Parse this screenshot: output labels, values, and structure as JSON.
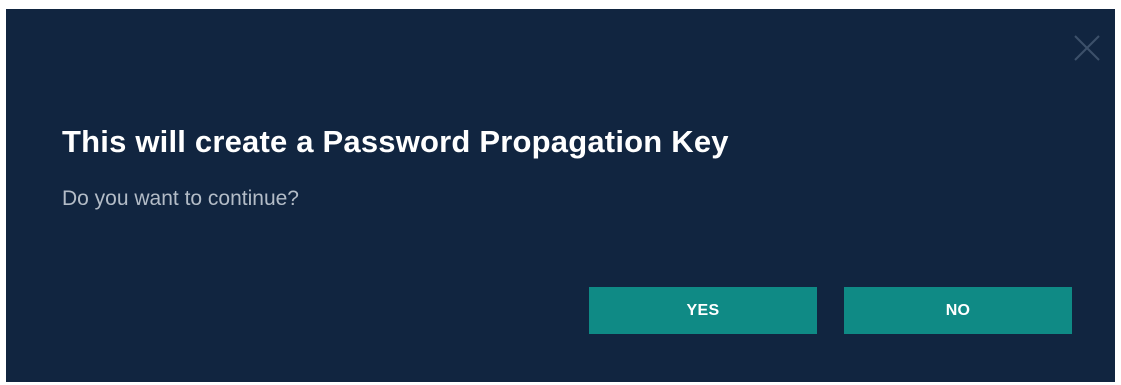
{
  "dialog": {
    "title": "This will create a Password Propagation Key",
    "message": "Do you want to continue?",
    "close_icon": "close-icon",
    "buttons": {
      "yes_label": "YES",
      "no_label": "NO"
    },
    "colors": {
      "background": "#112540",
      "button": "#0f8a85",
      "title": "#ffffff",
      "message": "#b3bcc7",
      "close_icon": "#3c506a"
    }
  }
}
